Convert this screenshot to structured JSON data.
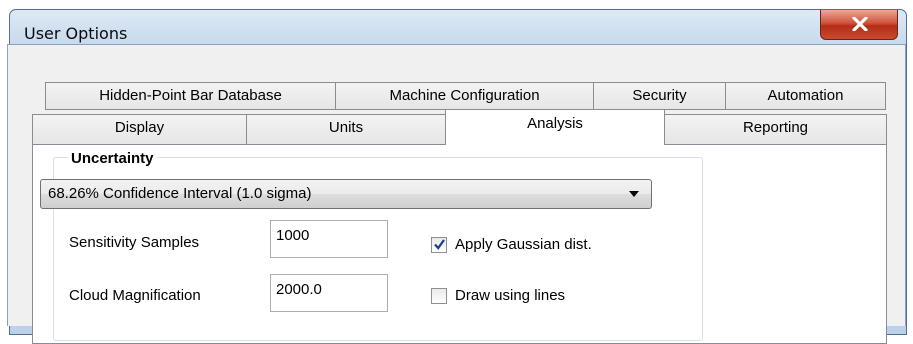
{
  "window": {
    "title": "User Options"
  },
  "tabs_back": [
    "Hidden-Point Bar Database",
    "Machine Configuration",
    "Security",
    "Automation"
  ],
  "tabs_front": [
    "Display",
    "Units",
    "Analysis",
    "Reporting"
  ],
  "active_tab": "Analysis",
  "uncertainty": {
    "heading": "Uncertainty",
    "confidence_select": "68.26% Confidence Interval (1.0 sigma)",
    "sensitivity_label": "Sensitivity Samples",
    "sensitivity_value": "1000",
    "cloud_label": "Cloud Magnification",
    "cloud_value": "2000.0",
    "gaussian_label": "Apply Gaussian dist.",
    "gaussian_checked": true,
    "lines_label": "Draw using lines",
    "lines_checked": false
  },
  "icons": {
    "close": "close-icon",
    "dropdown": "chevron-down-icon",
    "check": "checkmark-icon"
  },
  "colors": {
    "close_button": "#c94a2f",
    "titlebar": "#c4d7ec",
    "checkmark": "#1f3f8a"
  }
}
